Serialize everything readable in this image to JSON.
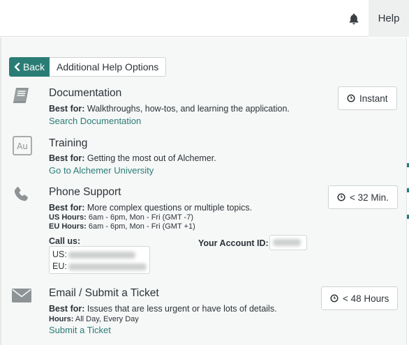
{
  "header": {
    "help_label": "Help"
  },
  "nav": {
    "back_label": "Back",
    "additional_label": "Additional Help Options"
  },
  "sections": {
    "documentation": {
      "title": "Documentation",
      "best_for_label": "Best for:",
      "best_for_text": " Walkthroughs, how-tos, and learning the application.",
      "link": "Search Documentation",
      "badge": "Instant",
      "icon": "book-icon"
    },
    "training": {
      "title": "Training",
      "best_for_label": "Best for:",
      "best_for_text": " Getting the most out of Alchemer.",
      "link": "Go to Alchemer University",
      "icon": "alchemer-university-icon"
    },
    "phone": {
      "title": "Phone Support",
      "best_for_label": "Best for:",
      "best_for_text": " More complex questions or multiple topics.",
      "us_hours_label": "US Hours:",
      "us_hours_text": " 6am - 6pm, Mon - Fri (GMT -7)",
      "eu_hours_label": "EU Hours:",
      "eu_hours_text": " 6am - 6pm, Mon - Fri (GMT +1)",
      "call_us_label": "Call us:",
      "us_prefix": "US:",
      "eu_prefix": "EU:",
      "account_id_label": "Your Account ID:",
      "badge": "< 32 Min.",
      "icon": "phone-icon"
    },
    "email": {
      "title": "Email / Submit a Ticket",
      "best_for_label": "Best for:",
      "best_for_text": " Issues that are less urgent or have lots of details.",
      "hours_label": "Hours:",
      "hours_text": " All Day, Every Day",
      "link": "Submit a Ticket",
      "badge": "< 48 Hours",
      "icon": "envelope-icon"
    }
  },
  "colors": {
    "accent": "#2a7d75",
    "panel_bg": "#f6f7f7",
    "text": "#2c3338"
  }
}
